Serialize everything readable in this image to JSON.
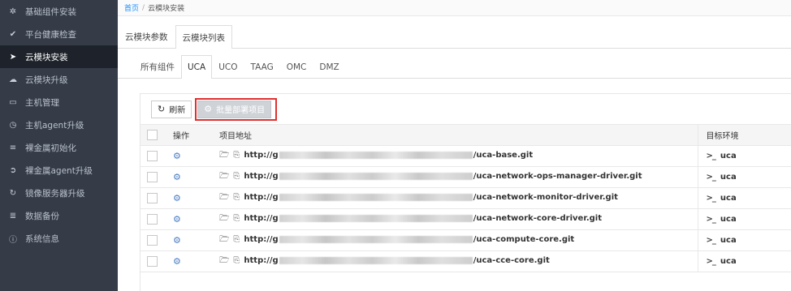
{
  "sidebar": {
    "items": [
      {
        "label": "基础组件安装",
        "icon": "gear-icon",
        "glyph": "✲"
      },
      {
        "label": "平台健康检查",
        "icon": "check-icon",
        "glyph": "✔"
      },
      {
        "label": "云模块安装",
        "icon": "paper-plane-icon",
        "glyph": "➤"
      },
      {
        "label": "云模块升级",
        "icon": "cloud-upload-icon",
        "glyph": "☁"
      },
      {
        "label": "主机管理",
        "icon": "monitor-icon",
        "glyph": "▭"
      },
      {
        "label": "主机agent升级",
        "icon": "clock-icon",
        "glyph": "◷"
      },
      {
        "label": "裸金属初始化",
        "icon": "server-icon",
        "glyph": "≡"
      },
      {
        "label": "裸金属agent升级",
        "icon": "circle-arrow-icon",
        "glyph": "➲"
      },
      {
        "label": "镜像服务器升级",
        "icon": "refresh-icon",
        "glyph": "↻"
      },
      {
        "label": "数据备份",
        "icon": "database-icon",
        "glyph": "≣"
      },
      {
        "label": "系统信息",
        "icon": "info-icon",
        "glyph": "ⓘ"
      }
    ],
    "active_index": 2
  },
  "breadcrumb": {
    "home": "首页",
    "separator": "/",
    "current": "云模块安装"
  },
  "tabs": [
    {
      "label": "云模块参数",
      "active": false
    },
    {
      "label": "云模块列表",
      "active": true
    }
  ],
  "subtabs": [
    {
      "label": "所有组件",
      "active": false
    },
    {
      "label": "UCA",
      "active": true
    },
    {
      "label": "UCO",
      "active": false
    },
    {
      "label": "TAAG",
      "active": false
    },
    {
      "label": "OMC",
      "active": false
    },
    {
      "label": "DMZ",
      "active": false
    }
  ],
  "toolbar": {
    "refresh_label": "刷新",
    "deploy_label": "批量部署项目"
  },
  "table": {
    "headers": {
      "operation": "操作",
      "address": "项目地址",
      "env": "目标环境"
    },
    "rows": [
      {
        "url_prefix": "http://g",
        "url_suffix": "/uca-base.git",
        "env": "uca"
      },
      {
        "url_prefix": "http://g",
        "url_suffix": "/uca-network-ops-manager-driver.git",
        "env": "uca"
      },
      {
        "url_prefix": "http://g",
        "url_suffix": "/uca-network-monitor-driver.git",
        "env": "uca"
      },
      {
        "url_prefix": "http://g",
        "url_suffix": "/uca-network-core-driver.git",
        "env": "uca"
      },
      {
        "url_prefix": "http://g",
        "url_suffix": "/uca-compute-core.git",
        "env": "uca"
      },
      {
        "url_prefix": "http://g",
        "url_suffix": "/uca-cce-core.git",
        "env": "uca"
      }
    ]
  },
  "colors": {
    "sidebar_bg": "#353c48",
    "sidebar_active_bg": "#1e232b",
    "link": "#1890ff",
    "highlight_border": "#e0312f",
    "gear": "#4a7cc2"
  }
}
